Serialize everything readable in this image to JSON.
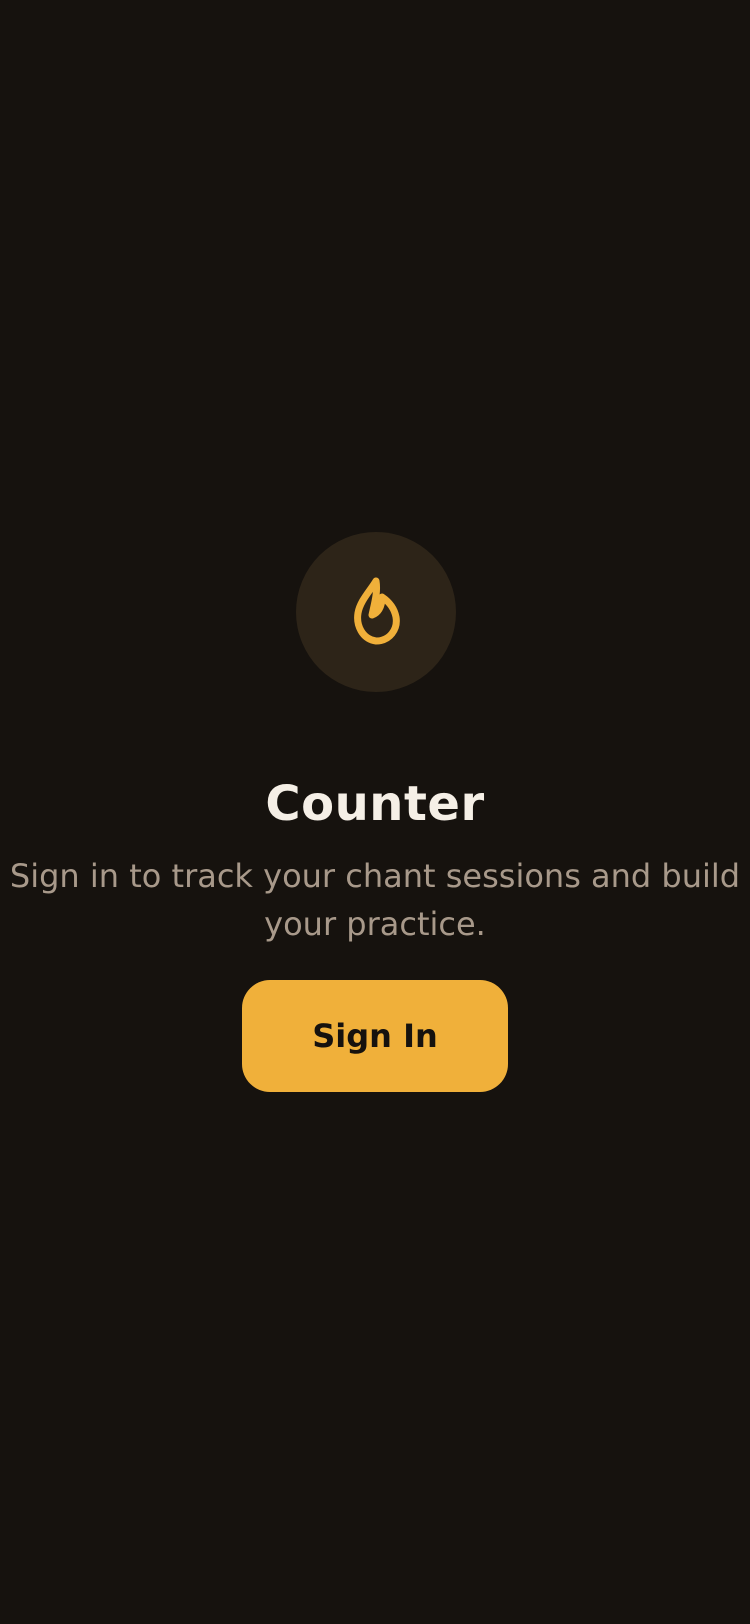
{
  "app": {
    "title": "Counter",
    "subtitle": "Sign in to track your chant sessions and build your practice."
  },
  "logo": {
    "icon": "flame-icon",
    "accent_color": "#f0b03a",
    "circle_color": "#2d2418"
  },
  "actions": {
    "sign_in_label": "Sign In"
  },
  "colors": {
    "background": "#16120e",
    "title": "#f5efe6",
    "subtitle": "#a8998a",
    "button": "#f0b03a",
    "button_text": "#16120e"
  }
}
